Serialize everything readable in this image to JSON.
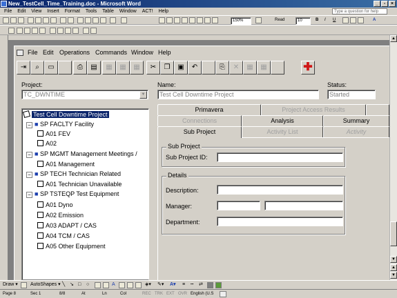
{
  "word": {
    "title": "New_TestCell_Time_Training.doc - Microsoft Word",
    "menu": [
      "File",
      "Edit",
      "View",
      "Insert",
      "Format",
      "Tools",
      "Table",
      "Window",
      "ACT!",
      "Help"
    ],
    "ask_placeholder": "Type a question for help",
    "zoom": "150%",
    "read_label": "Read",
    "font_size": "10"
  },
  "app": {
    "menu": [
      "File",
      "Edit",
      "Operations",
      "Commands",
      "Window",
      "Help"
    ],
    "project_label": "Project:",
    "project_value": "TC_DWNTIME",
    "name_label": "Name:",
    "name_value": "Test Cell Downtime Project",
    "status_label": "Status:",
    "status_value": "Started",
    "tree": {
      "root": "Test Cell Downtime Project",
      "nodes": [
        "SP FACLTY  Facility",
        "A01  FEV",
        "A02",
        "SP MGMT  Management Meetings /",
        "A01  Management",
        "SP TECH  Technician Related",
        "A01  Technician Unavailable",
        "SP TSTEQP  Test Equipment",
        "A01  Dyno",
        "A02  Emission",
        "A03  ADAPT / CAS",
        "A04  TCM / CAS",
        "A05  Other Equipment"
      ]
    },
    "tabs": {
      "row1": [
        "Primavera",
        "Project Access Results"
      ],
      "row2": [
        "Connections",
        "Analysis",
        "Summary"
      ],
      "row3": [
        "Sub Project",
        "Activity List",
        "Activity"
      ]
    },
    "sub_project_group": "Sub Project",
    "sub_project_id_label": "Sub Project ID:",
    "sub_project_id_value": "",
    "details_group": "Details",
    "description_label": "Description:",
    "description_value": "",
    "manager_label": "Manager:",
    "manager_value": "",
    "manager_name_value": "",
    "department_label": "Department:",
    "department_value": ""
  },
  "drawbar": {
    "draw_label": "Draw ▾",
    "autoshapes_label": "AutoShapes ▾"
  },
  "status": {
    "page": "Page  8",
    "sec": "Sec  1",
    "pages": "8/8",
    "at": "At",
    "ln": "Ln",
    "col": "Col",
    "rec": "REC",
    "trk": "TRK",
    "ext": "EXT",
    "ovr": "OVR",
    "lang": "English (U.S"
  }
}
